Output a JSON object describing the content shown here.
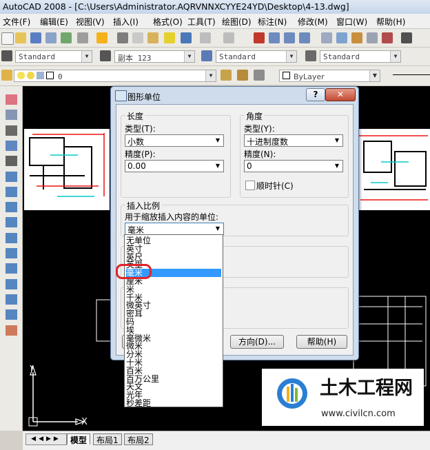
{
  "app": {
    "title": "AutoCAD 2008 - [C:\\Users\\Administrator.AQRVNNXCYYE24YD\\Desktop\\4-13.dwg]"
  },
  "menu": [
    {
      "id": "file",
      "label": "文件(F)"
    },
    {
      "id": "edit",
      "label": "编辑(E)"
    },
    {
      "id": "view",
      "label": "视图(V)"
    },
    {
      "id": "insert",
      "label": "插入(I)"
    },
    {
      "id": "format",
      "label": "格式(O)"
    },
    {
      "id": "tools",
      "label": "工具(T)"
    },
    {
      "id": "draw",
      "label": "绘图(D)"
    },
    {
      "id": "dimension",
      "label": "标注(N)"
    },
    {
      "id": "modify",
      "label": "修改(M)"
    },
    {
      "id": "window",
      "label": "窗口(W)"
    },
    {
      "id": "help",
      "label": "帮助(H)"
    }
  ],
  "styles_toolbar": {
    "text_style": "Standard",
    "dim_style": "副本 123",
    "table_style": "Standard",
    "mleader_style": "Standard"
  },
  "layers_toolbar": {
    "layer": "0",
    "color": "ByLayer"
  },
  "layout_tabs": [
    "模型",
    "布局1",
    "布局2"
  ],
  "ucs": {
    "x": "X",
    "y": "Y"
  },
  "dialog": {
    "title": "图形单位",
    "help_glyph": "?",
    "close_glyph": "✕",
    "length": {
      "group": "长度",
      "type_label": "类型(T):",
      "type_value": "小数",
      "precision_label": "精度(P):",
      "precision_value": "0.00"
    },
    "angle": {
      "group": "角度",
      "type_label": "类型(Y):",
      "type_value": "十进制度数",
      "precision_label": "精度(N):",
      "precision_value": "0",
      "clockwise_label": "顺时针(C)",
      "clockwise_checked": false
    },
    "insertion": {
      "group": "插入比例",
      "units_label": "用于缩放插入内容的单位:",
      "units_value": "毫米"
    },
    "buttons": {
      "direction": "方向(D)...",
      "help": "帮助(H)"
    },
    "unit_options": [
      "无单位",
      "英寸",
      "英尺",
      "英里",
      "毫米",
      "厘米",
      "米",
      "千米",
      "微英寸",
      "密耳",
      "码",
      "埃",
      "毫微米",
      "微米",
      "分米",
      "十米",
      "百米",
      "百万公里",
      "天文",
      "光年",
      "秒差距"
    ],
    "selected_option": "毫米"
  },
  "watermark": {
    "name": "土木工程网",
    "url": "www.civilcn.com"
  },
  "colors": {
    "selection": "#3399ff",
    "highlight_circle": "#e0242a",
    "canvas": "#000000"
  }
}
